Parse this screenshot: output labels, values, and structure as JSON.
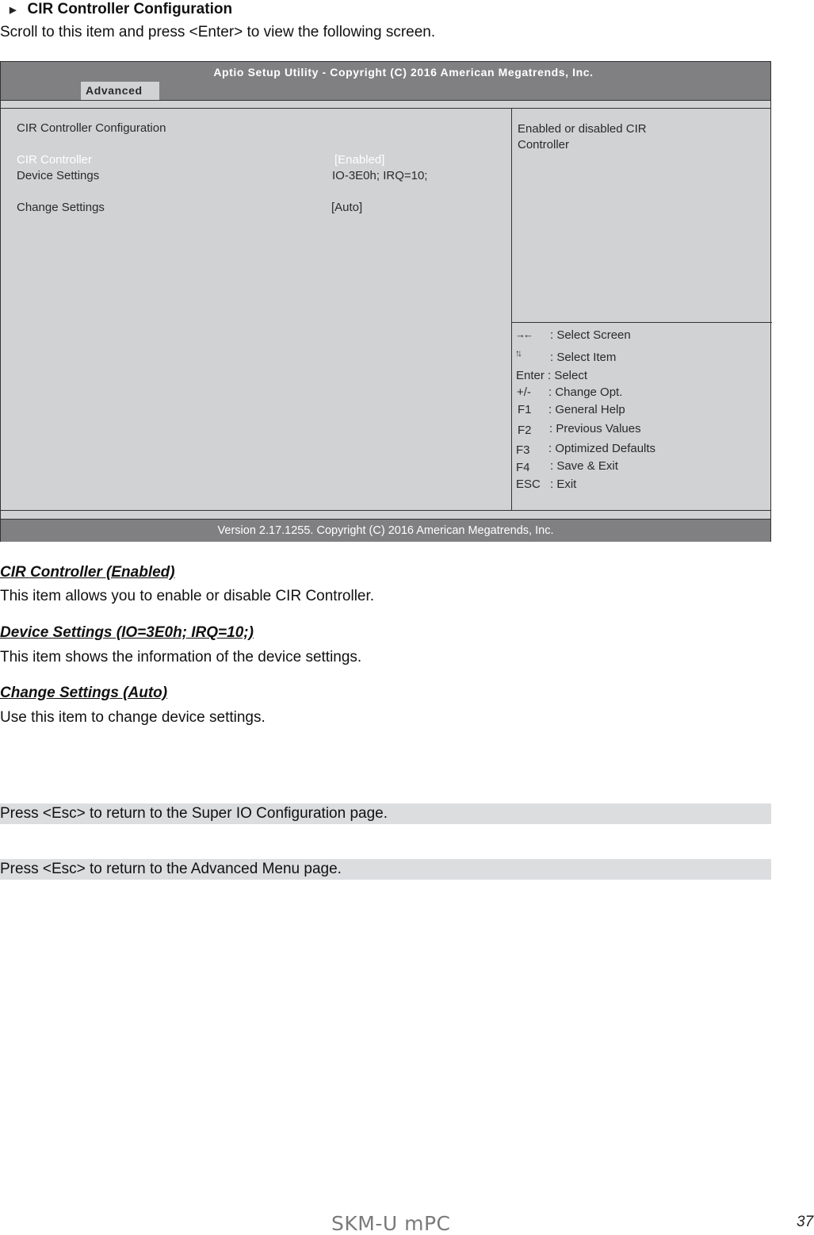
{
  "section": {
    "bullet_icon": "triangle-right-icon",
    "heading": "CIR Controller Configuration",
    "intro": "Scroll to this item and press <Enter> to view the following screen."
  },
  "bios": {
    "title": "Aptio Setup Utility - Copyright (C) 2016 American Megatrends, Inc.",
    "active_tab": "Advanced",
    "page_heading": "CIR Controller Configuration",
    "items": [
      {
        "label": "CIR Controller",
        "value": "[Enabled]",
        "selected": true
      },
      {
        "label": "Device Settings",
        "value": "IO-3E0h; IRQ=10;",
        "selected": false
      },
      {
        "label": "Change Settings",
        "value": "[Auto]",
        "selected": false
      }
    ],
    "help": "Enabled or disabled CIR Controller",
    "keys": [
      {
        "key": "→←",
        "desc": ": Select Screen",
        "icon": "left-right-arrows-icon"
      },
      {
        "key": "↑↓",
        "desc": ": Select Item",
        "icon": "up-down-arrows-icon"
      },
      {
        "key": "Enter",
        "desc": ": Select"
      },
      {
        "key": "+/-",
        "desc": ": Change Opt."
      },
      {
        "key": "F1",
        "desc": ": General Help"
      },
      {
        "key": "F2",
        "desc": ": Previous Values"
      },
      {
        "key": "F3",
        "desc": ": Optimized Defaults"
      },
      {
        "key": "F4",
        "desc": ": Save & Exit"
      },
      {
        "key": "ESC",
        "desc": ": Exit"
      }
    ],
    "footer": "Version 2.17.1255. Copyright (C) 2016 American Megatrends, Inc.",
    "colors": {
      "bar": "#808083",
      "panel": "#d1d2d4",
      "highlight_text": "#ffffff"
    }
  },
  "descriptions": [
    {
      "title": "CIR Controller (Enabled)",
      "text": "This item allows you to enable or disable CIR Controller."
    },
    {
      "title": "Device Settings (IO=3E0h; IRQ=10;)",
      "text": "This item shows the information of the device settings."
    },
    {
      "title": "Change Settings (Auto)",
      "text": "Use this item to change device settings."
    }
  ],
  "notes": [
    "Press <Esc> to return to the Super IO Configuration page.",
    "Press <Esc> to return to the Advanced Menu page."
  ],
  "page_footer": {
    "brand": "SKM-U mPC",
    "page_number": "37"
  }
}
